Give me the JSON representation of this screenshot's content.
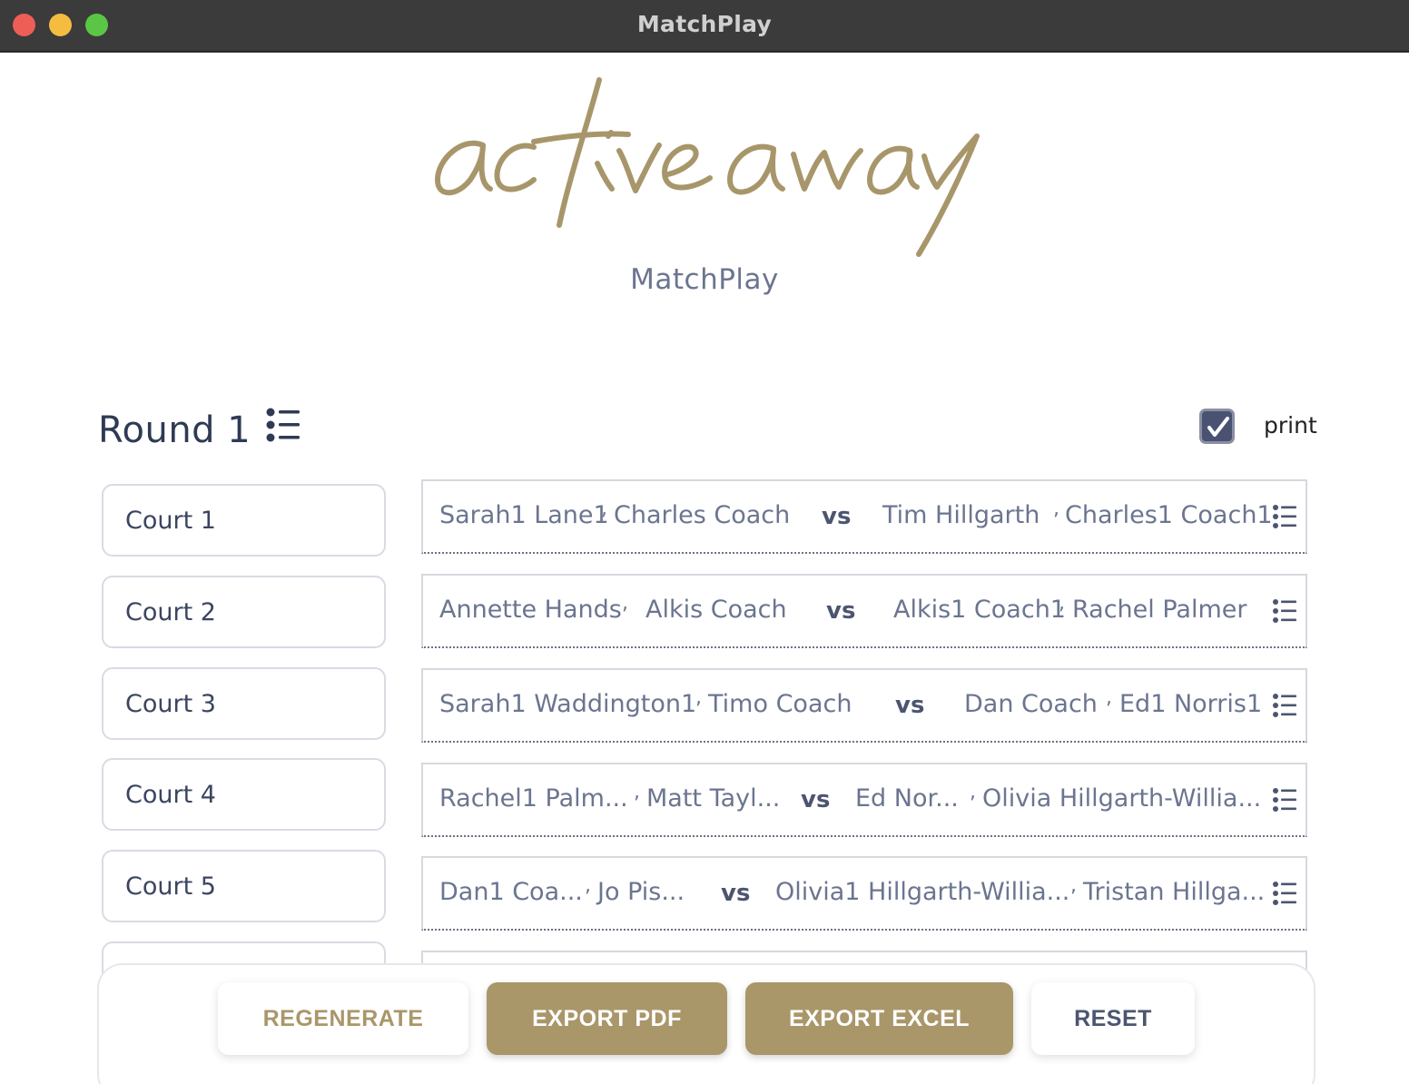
{
  "window": {
    "title": "MatchPlay"
  },
  "app": {
    "logo_text": "activeaway",
    "subtitle": "MatchPlay"
  },
  "round": {
    "title": "Round 1",
    "print_label": "print",
    "print_checked": true
  },
  "courts": [
    {
      "label": "Court 1"
    },
    {
      "label": "Court 2"
    },
    {
      "label": "Court 3"
    },
    {
      "label": "Court 4"
    },
    {
      "label": "Court 5"
    }
  ],
  "matches": [
    {
      "team_a_p1": "Sarah1 Lane1",
      "team_a_p2": "Charles Coach",
      "vs": "vs",
      "team_b_p1": "Tim Hillgarth",
      "team_b_p2": "Charles1 Coach1"
    },
    {
      "team_a_p1": "Annette Hands",
      "team_a_p2": "Alkis Coach",
      "vs": "vs",
      "team_b_p1": "Alkis1 Coach1",
      "team_b_p2": "Rachel Palmer"
    },
    {
      "team_a_p1": "Sarah1 Waddington1",
      "team_a_p2": "Timo Coach",
      "vs": "vs",
      "team_b_p1": "Dan Coach",
      "team_b_p2": "Ed1 Norris1"
    },
    {
      "team_a_p1": "Rachel1 Palm...",
      "team_a_p2": "Matt Tayl...",
      "vs": "vs",
      "team_b_p1": "Ed Nor...",
      "team_b_p2": "Olivia Hillgarth-Willia..."
    },
    {
      "team_a_p1": "Dan1 Coa...",
      "team_a_p2": "Jo Pis...",
      "vs": "vs",
      "team_b_p1": "Olivia1 Hillgarth-Willia...",
      "team_b_p2": "Tristan Hillga..."
    }
  ],
  "footer": {
    "regenerate": "REGENERATE",
    "export_pdf": "EXPORT PDF",
    "export_excel": "EXPORT EXCEL",
    "reset": "RESET"
  },
  "colors": {
    "gold": "#a9976a",
    "navy": "#2f3a55",
    "muted": "#6b7590"
  },
  "icons": {
    "round_menu": "list-bullet-icon",
    "match_menu": "list-bullet-icon",
    "print": "checkbox-checked-icon"
  }
}
